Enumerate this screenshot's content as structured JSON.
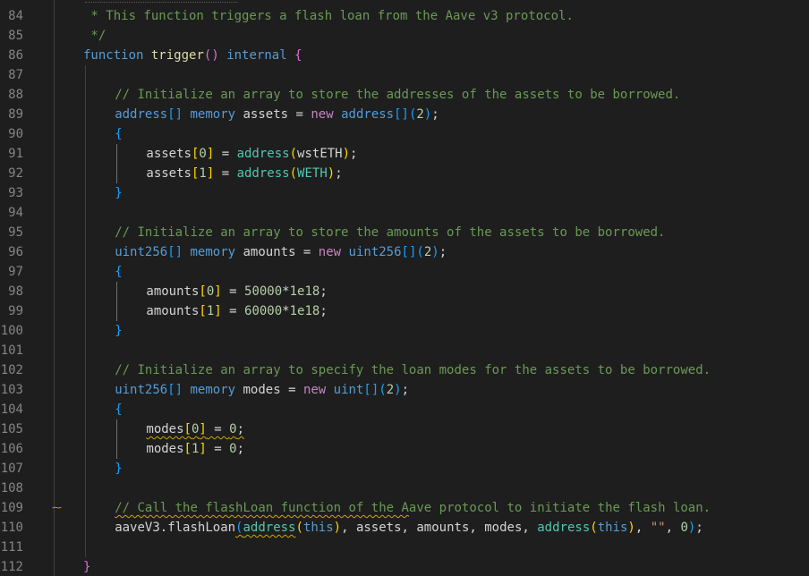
{
  "editor": {
    "language": "solidity",
    "theme_colors": {
      "background": "#1e1e1e",
      "comment": "#6a9955",
      "keyword": "#569cd6",
      "control": "#c586c0",
      "function": "#dcdcaa",
      "type": "#4ec9b0",
      "number": "#b5cea8",
      "string": "#ce9178",
      "bracket_level1": "#ffd700",
      "bracket_level2": "#da70d6",
      "bracket_level3": "#179fff",
      "warning": "#cca700"
    },
    "lines": [
      {
        "n": "84",
        "indent": 1,
        "tokens": [
          {
            "t": " * This function triggers a flash loan from the Aave v3 protocol.",
            "c": "c-comment"
          }
        ]
      },
      {
        "n": "85",
        "indent": 1,
        "tokens": [
          {
            "t": " */",
            "c": "c-comment"
          }
        ]
      },
      {
        "n": "86",
        "indent": 1,
        "tokens": [
          {
            "t": "function",
            "c": "c-kw"
          },
          {
            "t": " "
          },
          {
            "t": "trigger",
            "c": "c-fn"
          },
          {
            "t": "()",
            "c": "c-b2"
          },
          {
            "t": " "
          },
          {
            "t": "internal",
            "c": "c-kw"
          },
          {
            "t": " "
          },
          {
            "t": "{",
            "c": "c-b2"
          }
        ]
      },
      {
        "n": "87",
        "indent": 1,
        "tokens": []
      },
      {
        "n": "88",
        "indent": 2,
        "tokens": [
          {
            "t": "// Initialize an array to store the addresses of the assets to be borrowed.",
            "c": "c-comment"
          }
        ]
      },
      {
        "n": "89",
        "indent": 2,
        "tokens": [
          {
            "t": "address",
            "c": "c-kw"
          },
          {
            "t": "[]",
            "c": "c-b3"
          },
          {
            "t": " "
          },
          {
            "t": "memory",
            "c": "c-kw"
          },
          {
            "t": " assets = "
          },
          {
            "t": "new",
            "c": "c-ctrl"
          },
          {
            "t": " "
          },
          {
            "t": "address",
            "c": "c-kw"
          },
          {
            "t": "[]",
            "c": "c-b3"
          },
          {
            "t": "(",
            "c": "c-b3"
          },
          {
            "t": "2",
            "c": "c-num"
          },
          {
            "t": ")",
            "c": "c-b3"
          },
          {
            "t": ";"
          }
        ]
      },
      {
        "n": "90",
        "indent": 2,
        "tokens": [
          {
            "t": "{",
            "c": "c-b3"
          }
        ]
      },
      {
        "n": "91",
        "indent": 3,
        "tokens": [
          {
            "t": "assets"
          },
          {
            "t": "[",
            "c": "c-b1"
          },
          {
            "t": "0",
            "c": "c-num"
          },
          {
            "t": "]",
            "c": "c-b1"
          },
          {
            "t": " = "
          },
          {
            "t": "address",
            "c": "c-type"
          },
          {
            "t": "(",
            "c": "c-b1"
          },
          {
            "t": "wstETH"
          },
          {
            "t": ")",
            "c": "c-b1"
          },
          {
            "t": ";"
          }
        ]
      },
      {
        "n": "92",
        "indent": 3,
        "tokens": [
          {
            "t": "assets"
          },
          {
            "t": "[",
            "c": "c-b1"
          },
          {
            "t": "1",
            "c": "c-num"
          },
          {
            "t": "]",
            "c": "c-b1"
          },
          {
            "t": " = "
          },
          {
            "t": "address",
            "c": "c-type"
          },
          {
            "t": "(",
            "c": "c-b1"
          },
          {
            "t": "WETH",
            "c": "c-type"
          },
          {
            "t": ")",
            "c": "c-b1"
          },
          {
            "t": ";"
          }
        ]
      },
      {
        "n": "93",
        "indent": 2,
        "tokens": [
          {
            "t": "}",
            "c": "c-b3"
          }
        ]
      },
      {
        "n": "94",
        "indent": 2,
        "tokens": []
      },
      {
        "n": "95",
        "indent": 2,
        "tokens": [
          {
            "t": "// Initialize an array to store the amounts of the assets to be borrowed.",
            "c": "c-comment"
          }
        ]
      },
      {
        "n": "96",
        "indent": 2,
        "tokens": [
          {
            "t": "uint256",
            "c": "c-kw"
          },
          {
            "t": "[]",
            "c": "c-b3"
          },
          {
            "t": " "
          },
          {
            "t": "memory",
            "c": "c-kw"
          },
          {
            "t": " amounts = "
          },
          {
            "t": "new",
            "c": "c-ctrl"
          },
          {
            "t": " "
          },
          {
            "t": "uint256",
            "c": "c-kw"
          },
          {
            "t": "[]",
            "c": "c-b3"
          },
          {
            "t": "(",
            "c": "c-b3"
          },
          {
            "t": "2",
            "c": "c-num"
          },
          {
            "t": ")",
            "c": "c-b3"
          },
          {
            "t": ";"
          }
        ]
      },
      {
        "n": "97",
        "indent": 2,
        "tokens": [
          {
            "t": "{",
            "c": "c-b3"
          }
        ]
      },
      {
        "n": "98",
        "indent": 3,
        "tokens": [
          {
            "t": "amounts"
          },
          {
            "t": "[",
            "c": "c-b1"
          },
          {
            "t": "0",
            "c": "c-num"
          },
          {
            "t": "]",
            "c": "c-b1"
          },
          {
            "t": " = "
          },
          {
            "t": "50000",
            "c": "c-num"
          },
          {
            "t": "*"
          },
          {
            "t": "1e18",
            "c": "c-num"
          },
          {
            "t": ";"
          }
        ]
      },
      {
        "n": "99",
        "indent": 3,
        "tokens": [
          {
            "t": "amounts"
          },
          {
            "t": "[",
            "c": "c-b1"
          },
          {
            "t": "1",
            "c": "c-num"
          },
          {
            "t": "]",
            "c": "c-b1"
          },
          {
            "t": " = "
          },
          {
            "t": "60000",
            "c": "c-num"
          },
          {
            "t": "*"
          },
          {
            "t": "1e18",
            "c": "c-num"
          },
          {
            "t": ";"
          }
        ]
      },
      {
        "n": "100",
        "indent": 2,
        "tokens": [
          {
            "t": "}",
            "c": "c-b3"
          }
        ]
      },
      {
        "n": "101",
        "indent": 2,
        "tokens": []
      },
      {
        "n": "102",
        "indent": 2,
        "tokens": [
          {
            "t": "// Initialize an array to specify the loan modes for the assets to be borrowed.",
            "c": "c-comment"
          }
        ]
      },
      {
        "n": "103",
        "indent": 2,
        "tokens": [
          {
            "t": "uint256",
            "c": "c-kw"
          },
          {
            "t": "[]",
            "c": "c-b3"
          },
          {
            "t": " "
          },
          {
            "t": "memory",
            "c": "c-kw"
          },
          {
            "t": " modes = "
          },
          {
            "t": "new",
            "c": "c-ctrl"
          },
          {
            "t": " "
          },
          {
            "t": "uint",
            "c": "c-kw"
          },
          {
            "t": "[]",
            "c": "c-b3"
          },
          {
            "t": "(",
            "c": "c-b3"
          },
          {
            "t": "2",
            "c": "c-num"
          },
          {
            "t": ")",
            "c": "c-b3"
          },
          {
            "t": ";"
          }
        ]
      },
      {
        "n": "104",
        "indent": 2,
        "tokens": [
          {
            "t": "{",
            "c": "c-b3"
          }
        ]
      },
      {
        "n": "105",
        "indent": 3,
        "squiggle": true,
        "tokens": [
          {
            "t": "modes"
          },
          {
            "t": "[",
            "c": "c-b1"
          },
          {
            "t": "0",
            "c": "c-num"
          },
          {
            "t": "]",
            "c": "c-b1"
          },
          {
            "t": " = "
          },
          {
            "t": "0",
            "c": "c-num"
          },
          {
            "t": ";"
          }
        ]
      },
      {
        "n": "106",
        "indent": 3,
        "tokens": [
          {
            "t": "modes"
          },
          {
            "t": "[",
            "c": "c-b1"
          },
          {
            "t": "1",
            "c": "c-num"
          },
          {
            "t": "]",
            "c": "c-b1"
          },
          {
            "t": " = "
          },
          {
            "t": "0",
            "c": "c-num"
          },
          {
            "t": ";"
          }
        ]
      },
      {
        "n": "107",
        "indent": 2,
        "tokens": [
          {
            "t": "}",
            "c": "c-b3"
          }
        ]
      },
      {
        "n": "108",
        "indent": 2,
        "tokens": []
      },
      {
        "n": "109",
        "indent": 2,
        "squiggle_prefix": 39,
        "tokens": [
          {
            "t": "// Call the flashLoan function of the Aave protocol to initiate the flash loan.",
            "c": "c-comment"
          }
        ]
      },
      {
        "n": "110",
        "indent": 2,
        "tokens": [
          {
            "t": "aaveV3.flashLoan"
          },
          {
            "t": "(",
            "c": "c-b3",
            "sq": true
          },
          {
            "t": "address",
            "c": "c-type",
            "sq": true
          },
          {
            "t": "(",
            "c": "c-b1"
          },
          {
            "t": "this",
            "c": "c-kw"
          },
          {
            "t": ")",
            "c": "c-b1"
          },
          {
            "t": ", assets, amounts, modes, "
          },
          {
            "t": "address",
            "c": "c-type"
          },
          {
            "t": "(",
            "c": "c-b1"
          },
          {
            "t": "this",
            "c": "c-kw"
          },
          {
            "t": ")",
            "c": "c-b1"
          },
          {
            "t": ", "
          },
          {
            "t": "\"\"",
            "c": "c-str"
          },
          {
            "t": ", "
          },
          {
            "t": "0",
            "c": "c-num"
          },
          {
            "t": ")",
            "c": "c-b3"
          },
          {
            "t": ";"
          }
        ]
      },
      {
        "n": "111",
        "indent": 1,
        "tokens": []
      },
      {
        "n": "112",
        "indent": 1,
        "tokens": [
          {
            "t": "}",
            "c": "c-b2"
          }
        ]
      }
    ],
    "glyph_line": "109",
    "glyph_icon": "warning-squiggle-glyph-icon"
  }
}
